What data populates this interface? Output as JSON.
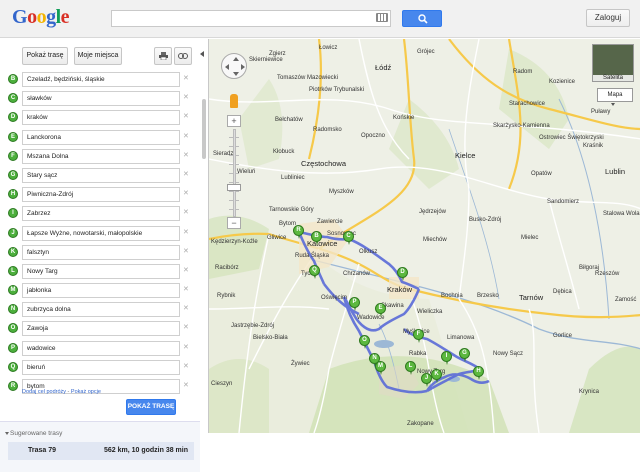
{
  "header": {
    "logo": [
      "G",
      "o",
      "o",
      "g",
      "l",
      "e"
    ],
    "search_value": "",
    "signin_label": "Zaloguj"
  },
  "panel": {
    "get_directions_tab": "Pokaż trasę",
    "my_places_tab": "Moje miejsca",
    "waypoints": [
      {
        "letter": "B",
        "value": "Czeladź, będziński, śląskie"
      },
      {
        "letter": "C",
        "value": "sławków"
      },
      {
        "letter": "D",
        "value": "kraków"
      },
      {
        "letter": "E",
        "value": "Lanckorona"
      },
      {
        "letter": "F",
        "value": "Mszana Dolna"
      },
      {
        "letter": "G",
        "value": "Stary sącz"
      },
      {
        "letter": "H",
        "value": "Piwniczna-Zdrój"
      },
      {
        "letter": "I",
        "value": "Zabrzez"
      },
      {
        "letter": "J",
        "value": "Łapsze Wyżne, nowotarski, małopolskie"
      },
      {
        "letter": "K",
        "value": "falsztyn"
      },
      {
        "letter": "L",
        "value": "Nowy Targ"
      },
      {
        "letter": "M",
        "value": "jabłonka"
      },
      {
        "letter": "N",
        "value": "zubrzyca dolna"
      },
      {
        "letter": "O",
        "value": "Zawoja"
      },
      {
        "letter": "P",
        "value": "wadowice"
      },
      {
        "letter": "Q",
        "value": "bieruń"
      },
      {
        "letter": "R",
        "value": "bytom"
      }
    ],
    "add_destination": "Dodaj cel podróży",
    "show_options": "Pokaż opcje",
    "link_separator": " - ",
    "directions_button": "POKAŻ TRASĘ",
    "suggested_title": "Sugerowane trasy",
    "route_name": "Trasa 79",
    "route_info": "562 km, 10 godzin 38 min"
  },
  "map": {
    "satellite_label": "Satelita",
    "map_type_label": "Mapa",
    "zoom_in": "+",
    "zoom_out": "−",
    "colors": {
      "route": "#5a6bd8",
      "marker": "#5cb83f",
      "highway": "#f6c94a",
      "road": "#ffffff",
      "water": "#9cb8d6",
      "forest": "#cfe1b4"
    },
    "cities": [
      {
        "name": "Łódź",
        "big": true
      },
      {
        "name": "Skierniewice",
        "big": false
      },
      {
        "name": "Piotrków Trybunalski",
        "big": false
      },
      {
        "name": "Radom",
        "big": false
      },
      {
        "name": "Kozienice",
        "big": false
      },
      {
        "name": "Puławy",
        "big": false
      },
      {
        "name": "Tomaszów Mazowiecki",
        "big": false
      },
      {
        "name": "Częstochowa",
        "big": true
      },
      {
        "name": "Kielce",
        "big": true
      },
      {
        "name": "Skarżysko-Kamienna",
        "big": false
      },
      {
        "name": "Ostrowiec Świętokrzyski",
        "big": false
      },
      {
        "name": "Starachowice",
        "big": false
      },
      {
        "name": "Zawiercie",
        "big": false
      },
      {
        "name": "Katowice",
        "big": true
      },
      {
        "name": "Gliwice",
        "big": false
      },
      {
        "name": "Bytom",
        "big": false
      },
      {
        "name": "Tarnowskie Góry",
        "big": false
      },
      {
        "name": "Sosnowiec",
        "big": false
      },
      {
        "name": "Kraków",
        "big": true
      },
      {
        "name": "Tychy",
        "big": false
      },
      {
        "name": "Rybnik",
        "big": false
      },
      {
        "name": "Ruda Śląska",
        "big": false
      },
      {
        "name": "Bielsko-Biała",
        "big": false
      },
      {
        "name": "Oświęcim",
        "big": false
      },
      {
        "name": "Chrzanów",
        "big": false
      },
      {
        "name": "Tarnów",
        "big": true
      },
      {
        "name": "Dębica",
        "big": false
      },
      {
        "name": "Mielec",
        "big": false
      },
      {
        "name": "Stalowa Wola",
        "big": false
      },
      {
        "name": "Sandomierz",
        "big": false
      },
      {
        "name": "Nowy Sącz",
        "big": false
      },
      {
        "name": "Nowy Targ",
        "big": false
      },
      {
        "name": "Zakopane",
        "big": false
      },
      {
        "name": "Gorlice",
        "big": false
      },
      {
        "name": "Rzeszów",
        "big": false
      },
      {
        "name": "Krynica",
        "big": false
      },
      {
        "name": "Myślenice",
        "big": false
      },
      {
        "name": "Rabka",
        "big": false
      },
      {
        "name": "Wadowice",
        "big": false
      },
      {
        "name": "Jastrzębie-Zdrój",
        "big": false
      },
      {
        "name": "Kędzierzyn-Koźle",
        "big": false
      },
      {
        "name": "Cieszyn",
        "big": false
      },
      {
        "name": "Limanowa",
        "big": false
      },
      {
        "name": "Bochnia",
        "big": false
      },
      {
        "name": "Brzesko",
        "big": false
      },
      {
        "name": "Wieliczka",
        "big": false
      },
      {
        "name": "Racibórz",
        "big": false
      },
      {
        "name": "Olkusz",
        "big": false
      },
      {
        "name": "Końskie",
        "big": false
      },
      {
        "name": "Lublin",
        "big": true
      },
      {
        "name": "Kraśnik",
        "big": false
      },
      {
        "name": "Zamość",
        "big": false
      },
      {
        "name": "Biłgoraj",
        "big": false
      },
      {
        "name": "Opatów",
        "big": false
      },
      {
        "name": "Jędrzejów",
        "big": false
      },
      {
        "name": "Busko-Zdrój",
        "big": false
      },
      {
        "name": "Miechów",
        "big": false
      },
      {
        "name": "Żywiec",
        "big": false
      },
      {
        "name": "Skawina",
        "big": false
      },
      {
        "name": "Radomsko",
        "big": false
      },
      {
        "name": "Bełchatów",
        "big": false
      },
      {
        "name": "Opoczno",
        "big": false
      },
      {
        "name": "Zgierz",
        "big": false
      },
      {
        "name": "Łowicz",
        "big": false
      },
      {
        "name": "Grójec",
        "big": false
      },
      {
        "name": "Wieluń",
        "big": false
      },
      {
        "name": "Lubliniec",
        "big": false
      },
      {
        "name": "Kłobuck",
        "big": false
      },
      {
        "name": "Myszków",
        "big": false
      },
      {
        "name": "Sieradz",
        "big": false
      }
    ],
    "pins": [
      "B",
      "C",
      "D",
      "E",
      "F",
      "G",
      "H",
      "I",
      "J",
      "K",
      "L",
      "M",
      "N",
      "O",
      "P",
      "Q",
      "R"
    ]
  }
}
